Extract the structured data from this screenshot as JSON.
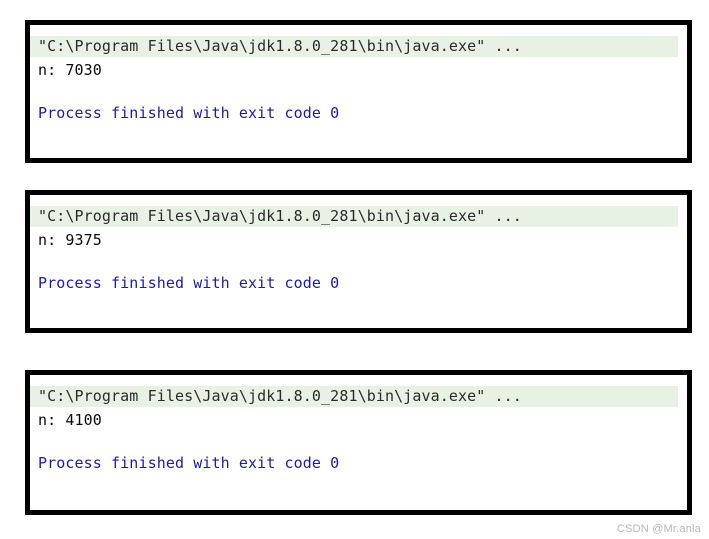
{
  "watermark": "CSDN @Mr.anla",
  "colors": {
    "panel_border": "#000000",
    "command_highlight_bg": "#e7f2e4",
    "command_text": "#2b2b2b",
    "output_text": "#0b0b0b",
    "finished_text": "#1c1ca8",
    "page_background": "#ffffff",
    "watermark_text": "#b9b9b9"
  },
  "panels": [
    {
      "command_line": "\"C:\\Program Files\\Java\\jdk1.8.0_281\\bin\\java.exe\" ...",
      "output_line": "n: 7030",
      "finished_line": "Process finished with exit code 0"
    },
    {
      "command_line": "\"C:\\Program Files\\Java\\jdk1.8.0_281\\bin\\java.exe\" ...",
      "output_line": "n: 9375",
      "finished_line": "Process finished with exit code 0"
    },
    {
      "command_line": "\"C:\\Program Files\\Java\\jdk1.8.0_281\\bin\\java.exe\" ...",
      "output_line": "n: 4100",
      "finished_line": "Process finished with exit code 0"
    }
  ]
}
